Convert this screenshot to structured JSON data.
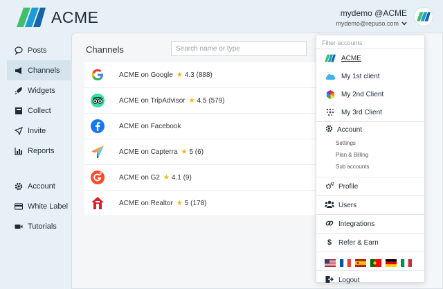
{
  "brand": {
    "name": "ACME"
  },
  "user": {
    "name": "mydemo @ACME",
    "email": "mydemo@repuso.com"
  },
  "sidebar": {
    "items": [
      {
        "label": "Posts",
        "icon": "comment-icon"
      },
      {
        "label": "Channels",
        "icon": "megaphone-icon"
      },
      {
        "label": "Widgets",
        "icon": "rocket-icon"
      },
      {
        "label": "Collect",
        "icon": "inbox-icon"
      },
      {
        "label": "Invite",
        "icon": "send-icon"
      },
      {
        "label": "Reports",
        "icon": "chart-icon"
      }
    ],
    "bottom_items": [
      {
        "label": "Account",
        "icon": "gear-icon"
      },
      {
        "label": "White Label",
        "icon": "card-icon"
      },
      {
        "label": "Tutorials",
        "icon": "video-icon"
      }
    ]
  },
  "main": {
    "title": "Channels",
    "search_placeholder": "Search name or type",
    "channels": [
      {
        "name": "ACME on Google",
        "rating": "4.3",
        "count": "(888)",
        "icon": "google-icon"
      },
      {
        "name": "ACME on TripAdvisor",
        "rating": "4.5",
        "count": "(579)",
        "icon": "tripadvisor-icon"
      },
      {
        "name": "ACME on Facebook",
        "rating": "",
        "count": "",
        "icon": "facebook-icon"
      },
      {
        "name": "ACME on Capterra",
        "rating": "5",
        "count": "(6)",
        "icon": "capterra-icon"
      },
      {
        "name": "ACME on G2",
        "rating": "4.1",
        "count": "(9)",
        "icon": "g2-icon"
      },
      {
        "name": "ACME on Realtor",
        "rating": "5",
        "count": "(178)",
        "icon": "realtor-icon"
      }
    ]
  },
  "dropdown": {
    "filter_placeholder": "Filter accounts",
    "accounts": [
      {
        "label": "ACME",
        "icon": "acme-logo-icon"
      },
      {
        "label": "My 1st client",
        "icon": "cloud-icon"
      },
      {
        "label": "My 2nd Client",
        "icon": "hexagon-icon"
      },
      {
        "label": "My 3rd Client",
        "icon": "dots-icon"
      }
    ],
    "account_section": {
      "label": "Account",
      "items": [
        "Settings",
        "Plan & Billing",
        "Sub accounts"
      ]
    },
    "menu": [
      {
        "label": "Profile",
        "icon": "gears-icon"
      },
      {
        "label": "Users",
        "icon": "users-icon"
      },
      {
        "label": "Integrations",
        "icon": "link-icon"
      },
      {
        "label": "Refer & Earn",
        "icon": "dollar-icon"
      }
    ],
    "languages": [
      "us-flag-icon",
      "fr-flag-icon",
      "es-flag-icon",
      "pt-flag-icon",
      "de-flag-icon",
      "it-flag-icon"
    ],
    "logout": "Logout"
  },
  "colors": {
    "accent": "#1d9bd7",
    "brand_green": "#3dbf6c",
    "star": "#f2b705"
  }
}
